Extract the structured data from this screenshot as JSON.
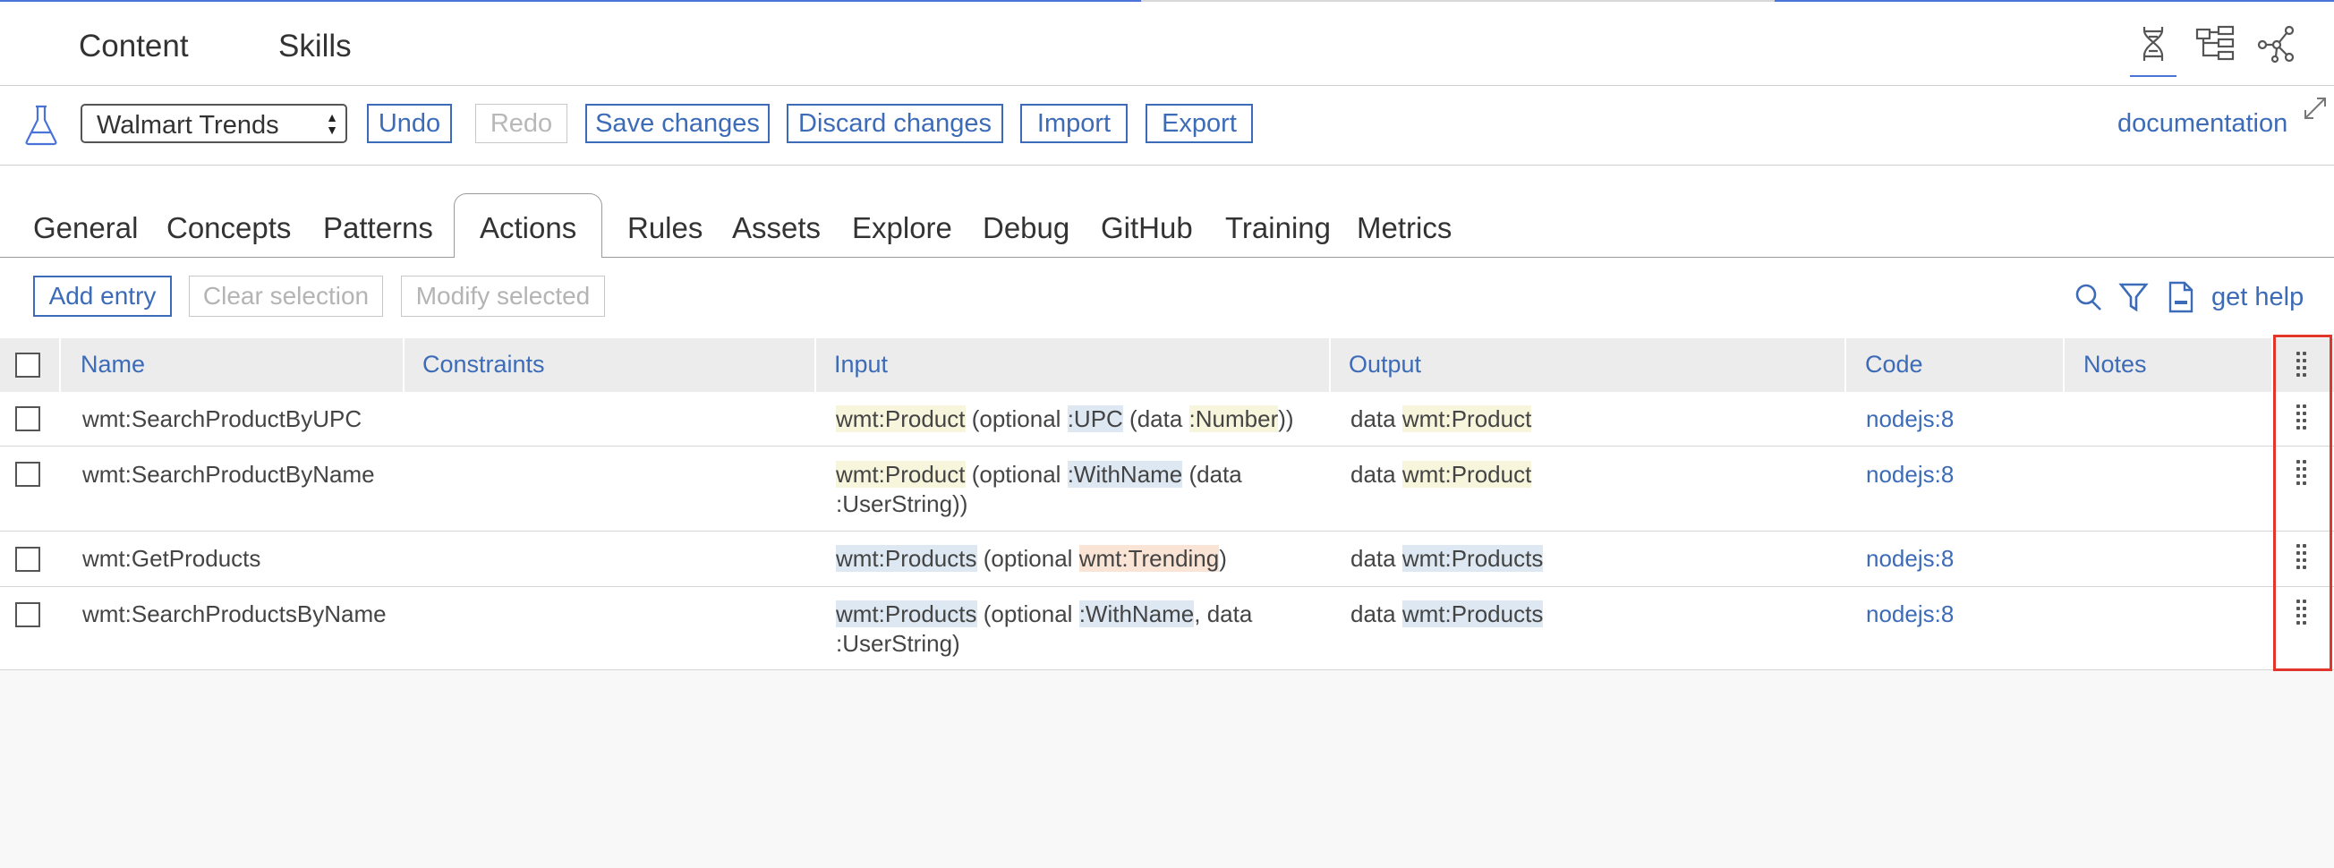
{
  "header": {
    "nav": [
      "Content",
      "Skills"
    ],
    "icons": [
      "dna-icon",
      "tree-icon",
      "graph-icon"
    ]
  },
  "toolbar": {
    "skill_select": "Walmart Trends",
    "undo": "Undo",
    "redo": "Redo",
    "save": "Save changes",
    "discard": "Discard changes",
    "import": "Import",
    "export": "Export",
    "documentation": "documentation"
  },
  "tabs": [
    "General",
    "Concepts",
    "Patterns",
    "Actions",
    "Rules",
    "Assets",
    "Explore",
    "Debug",
    "GitHub",
    "Training",
    "Metrics"
  ],
  "active_tab": "Actions",
  "actionbar": {
    "add_entry": "Add entry",
    "clear_selection": "Clear selection",
    "modify_selected": "Modify selected",
    "get_help": "get help"
  },
  "table": {
    "columns": [
      "Name",
      "Constraints",
      "Input",
      "Output",
      "Code",
      "Notes"
    ],
    "rows": [
      {
        "name": "wmt:SearchProductByUPC",
        "constraints": "",
        "input_parts": [
          "wmt:Product",
          " (optional ",
          ":UPC",
          " (data ",
          ":Number",
          "))"
        ],
        "output_parts": [
          "data ",
          "wmt:Product"
        ],
        "code": "nodejs:8",
        "notes": ""
      },
      {
        "name": "wmt:SearchProductByName",
        "constraints": "",
        "input_line1": [
          "wmt:Product",
          " (optional ",
          ":WithName",
          " (data"
        ],
        "input_line2": ":UserString))",
        "output_parts": [
          "data ",
          "wmt:Product"
        ],
        "code": "nodejs:8",
        "notes": ""
      },
      {
        "name": "wmt:GetProducts",
        "constraints": "",
        "input_parts": [
          "wmt:Products",
          " (optional ",
          "wmt:Trending",
          ")"
        ],
        "output_parts": [
          "data ",
          "wmt:Products"
        ],
        "code": "nodejs:8",
        "notes": ""
      },
      {
        "name": "wmt:SearchProductsByName",
        "constraints": "",
        "input_line1": [
          "wmt:Products",
          " (optional ",
          ":WithName",
          ", data"
        ],
        "input_line2": ":UserString)",
        "output_parts": [
          "data ",
          "wmt:Products"
        ],
        "code": "nodejs:8",
        "notes": ""
      }
    ]
  },
  "colors": {
    "accent": "#3c6bb8",
    "highlight_yellow": "#f7f5dc",
    "highlight_blue": "#dde8f2",
    "highlight_orange": "#fae4d5",
    "annotation_red": "#e0362c"
  }
}
